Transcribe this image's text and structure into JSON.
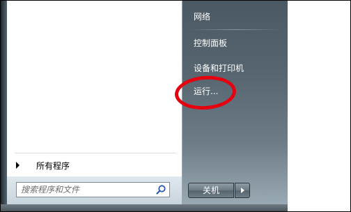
{
  "left_pane": {
    "all_programs_label": "所有程序",
    "search_placeholder": "搜索程序和文件"
  },
  "right_pane": {
    "items": [
      {
        "label": "网络"
      },
      {
        "label": "控制面板"
      },
      {
        "label": "设备和打印机"
      },
      {
        "label": "运行..."
      }
    ]
  },
  "shutdown": {
    "label": "关机"
  },
  "icons": {
    "search": "search-icon",
    "all_programs_arrow": "triangle-right-icon",
    "shutdown_options": "triangle-right-icon"
  },
  "colors": {
    "right_pane": "#56656f",
    "highlight": "#e4000f"
  }
}
